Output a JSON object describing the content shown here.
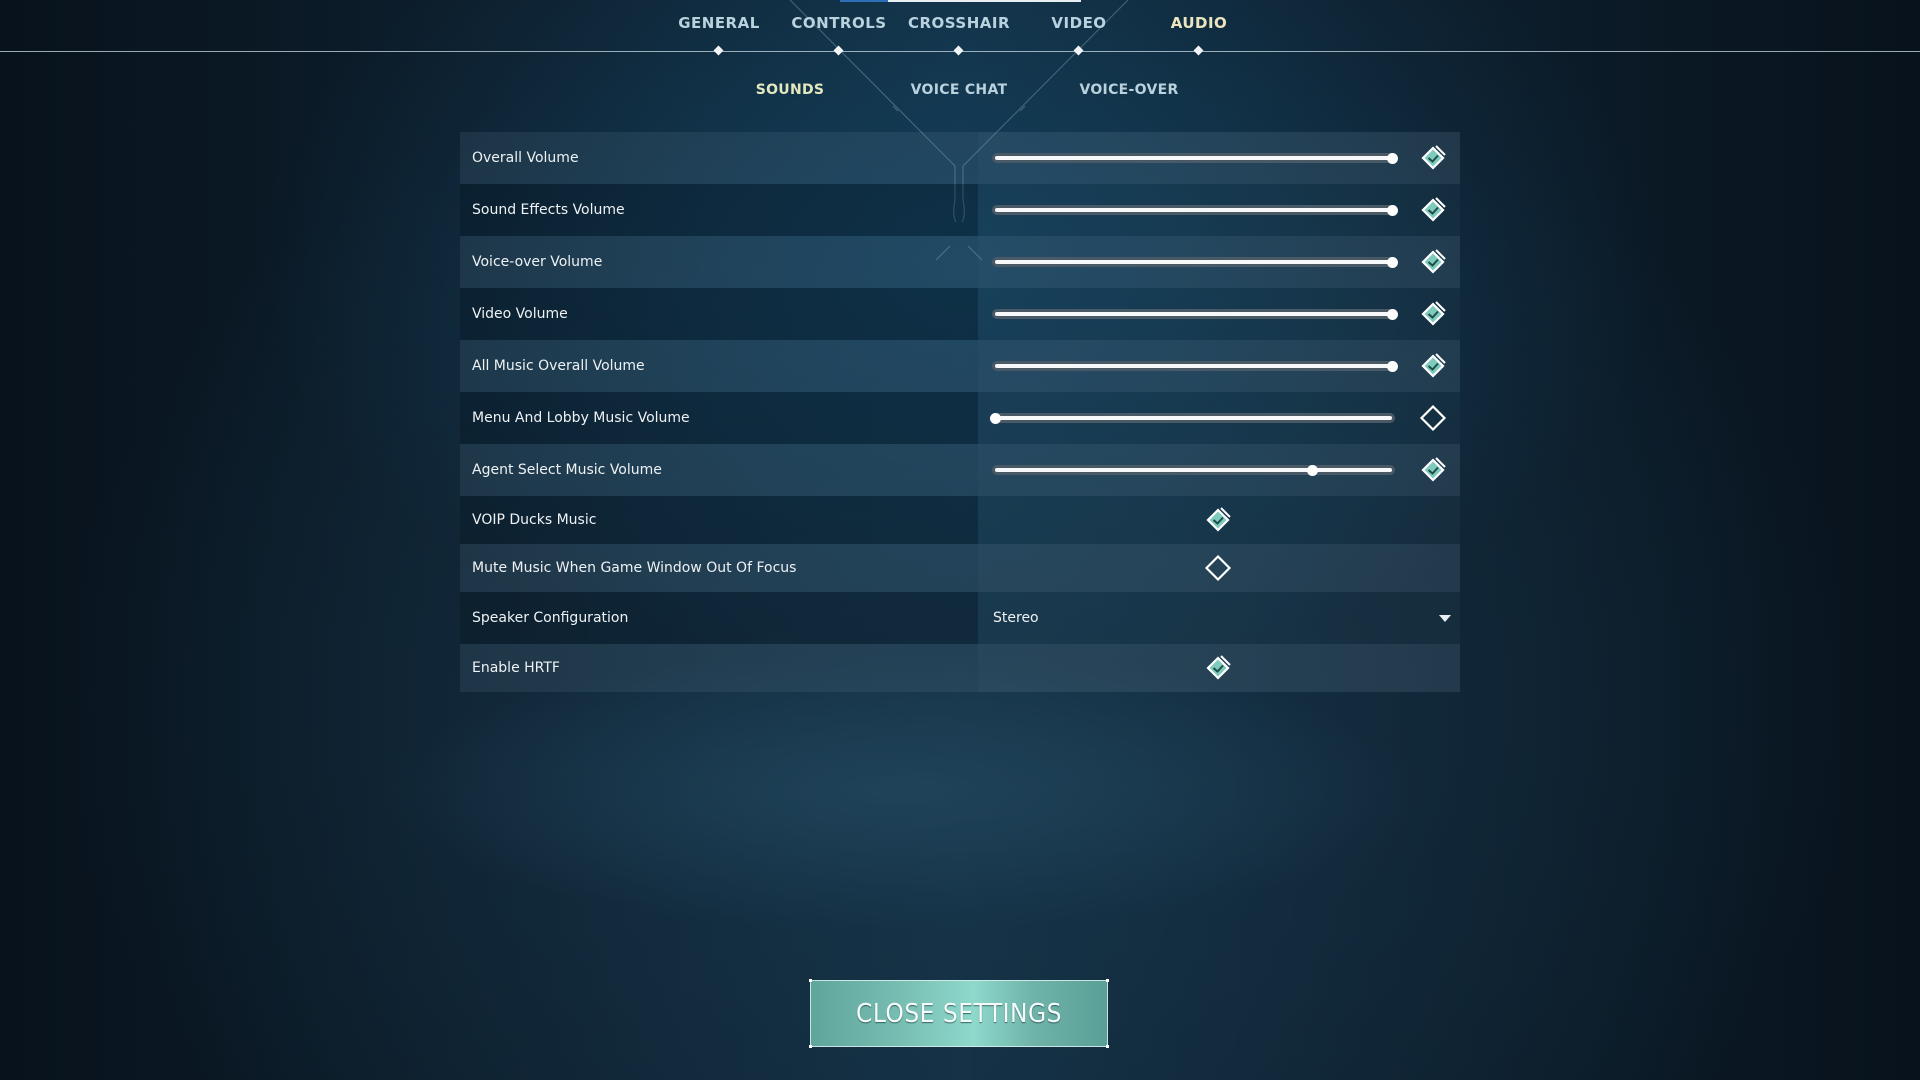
{
  "tabs": [
    {
      "label": "GENERAL",
      "active": false
    },
    {
      "label": "CONTROLS",
      "active": false
    },
    {
      "label": "CROSSHAIR",
      "active": false
    },
    {
      "label": "VIDEO",
      "active": false
    },
    {
      "label": "AUDIO",
      "active": true
    }
  ],
  "subtabs": [
    {
      "label": "SOUNDS",
      "active": true
    },
    {
      "label": "VOICE CHAT",
      "active": false
    },
    {
      "label": "VOICE-OVER",
      "active": false
    }
  ],
  "settings": [
    {
      "label": "Overall Volume",
      "type": "slider",
      "value": 1.0,
      "enabled": true
    },
    {
      "label": "Sound Effects Volume",
      "type": "slider",
      "value": 1.0,
      "enabled": true
    },
    {
      "label": "Voice-over Volume",
      "type": "slider",
      "value": 1.0,
      "enabled": true
    },
    {
      "label": "Video Volume",
      "type": "slider",
      "value": 1.0,
      "enabled": true
    },
    {
      "label": "All Music Overall Volume",
      "type": "slider",
      "value": 1.0,
      "enabled": true
    },
    {
      "label": "Menu And Lobby Music Volume",
      "type": "slider",
      "value": 0.0,
      "enabled": false
    },
    {
      "label": "Agent Select Music Volume",
      "type": "slider",
      "value": 0.8,
      "enabled": true
    },
    {
      "label": "VOIP Ducks Music",
      "type": "toggle",
      "checked": true
    },
    {
      "label": "Mute Music When Game Window Out Of Focus",
      "type": "toggle",
      "checked": false
    },
    {
      "label": "Speaker Configuration",
      "type": "dropdown",
      "value": "Stereo"
    },
    {
      "label": "Enable HRTF",
      "type": "toggle",
      "checked": true
    }
  ],
  "close_button": {
    "label": "CLOSE SETTINGS"
  },
  "colors": {
    "accent_teal": "#7ecbbd",
    "active_tab": "#ebe6c0",
    "inactive_tab": "#b9d2de"
  }
}
